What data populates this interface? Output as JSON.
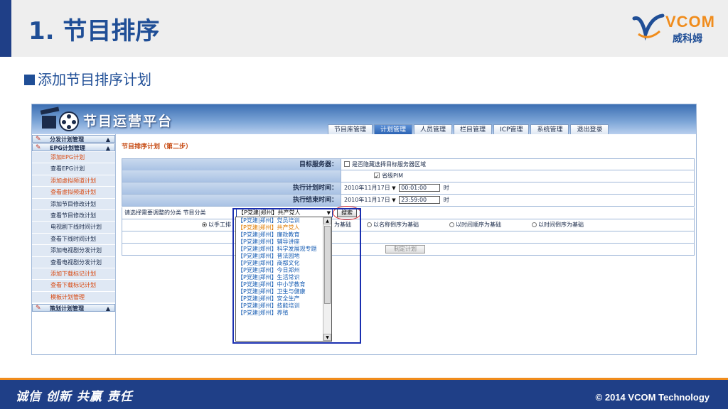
{
  "slide": {
    "title": "1. 节目排序",
    "subtitle": "添加节目排序计划",
    "logo_text": "VCOM",
    "logo_sub": "威科姆",
    "motto": "诚信 创新 共赢 责任",
    "copyright": "© 2014 VCOM Technology"
  },
  "colors": {
    "brand_blue": "#1f4e96",
    "brand_orange": "#f08c1c",
    "footer_bg": "#1f3f87"
  },
  "app": {
    "title": "节目运营平台",
    "nav_tabs": [
      {
        "label": "节目库管理",
        "active": false
      },
      {
        "label": "计划管理",
        "active": true
      },
      {
        "label": "人员管理",
        "active": false
      },
      {
        "label": "栏目管理",
        "active": false
      },
      {
        "label": "ICP管理",
        "active": false
      },
      {
        "label": "系统管理",
        "active": false
      },
      {
        "label": "退出登录",
        "active": false
      }
    ],
    "sidebar": {
      "group1": "分发计划管理",
      "group2": "EPG计划管理",
      "group3": "策划计划管理",
      "items": [
        {
          "label": "添加EPG计划",
          "style": "hl"
        },
        {
          "label": "查看EPG计划",
          "style": ""
        },
        {
          "label": "添加虚拟频道计划",
          "style": "hl"
        },
        {
          "label": "查看虚拟频道计划",
          "style": "hl"
        },
        {
          "label": "添加节目修改计划",
          "style": ""
        },
        {
          "label": "查看节目修改计划",
          "style": ""
        },
        {
          "label": "电视剧下线时间计划",
          "style": ""
        },
        {
          "label": "查看下线时间计划",
          "style": ""
        },
        {
          "label": "添加电视剧分发计划",
          "style": ""
        },
        {
          "label": "查看电视剧分发计划",
          "style": ""
        },
        {
          "label": "添加下载标记计划",
          "style": "hl"
        },
        {
          "label": "查看下载标记计划",
          "style": "hl"
        },
        {
          "label": "模板计划管理",
          "style": "hl"
        }
      ]
    },
    "main": {
      "step_title": "节目排序计划（第二步）",
      "target_server_label": "目标服务器：",
      "target_server_option": "是否隐藏选择目标服务器区域",
      "server_name": "省级PIM",
      "start_label": "执行计划时间：",
      "start_date": "2010年11月17日",
      "start_time": "00:01:00",
      "end_label": "执行结束时间：",
      "end_date": "2010年11月17日",
      "end_time": "23:59:00",
      "hour_unit": "时",
      "category_prompt": "请选择需要调整的分类 节目分类",
      "category_selected": "【P党建|郑州】共产党人",
      "search_button": "搜索",
      "radio_options": [
        {
          "label": "以手工排",
          "checked": true
        },
        {
          "label": "为基础",
          "checked": false
        },
        {
          "label": "以名称倒序为基础",
          "checked": false
        },
        {
          "label": "以时间顺序为基础",
          "checked": false
        },
        {
          "label": "以时间倒序为基础",
          "checked": false
        }
      ],
      "make_plan_button": "制定计划",
      "dropdown_items": [
        {
          "label": "【P党建|郑州】党员培训",
          "selected": false
        },
        {
          "label": "【P党建|郑州】共产党人",
          "selected": true
        },
        {
          "label": "【P党建|郑州】廉政教育",
          "selected": false
        },
        {
          "label": "【P党建|郑州】辅导讲座",
          "selected": false
        },
        {
          "label": "【P党建|郑州】科学发展观专题",
          "selected": false
        },
        {
          "label": "【P党建|郑州】普法园地",
          "selected": false
        },
        {
          "label": "【P党建|郑州】商都文化",
          "selected": false
        },
        {
          "label": "【P党建|郑州】今日郑州",
          "selected": false
        },
        {
          "label": "【P党建|郑州】生活常识",
          "selected": false
        },
        {
          "label": "【P党建|郑州】中小学教育",
          "selected": false
        },
        {
          "label": "【P党建|郑州】卫生与健康",
          "selected": false
        },
        {
          "label": "【P党建|郑州】安全生产",
          "selected": false
        },
        {
          "label": "【P党建|郑州】技能培训",
          "selected": false
        },
        {
          "label": "【P党建|郑州】养殖",
          "selected": false
        }
      ]
    }
  }
}
